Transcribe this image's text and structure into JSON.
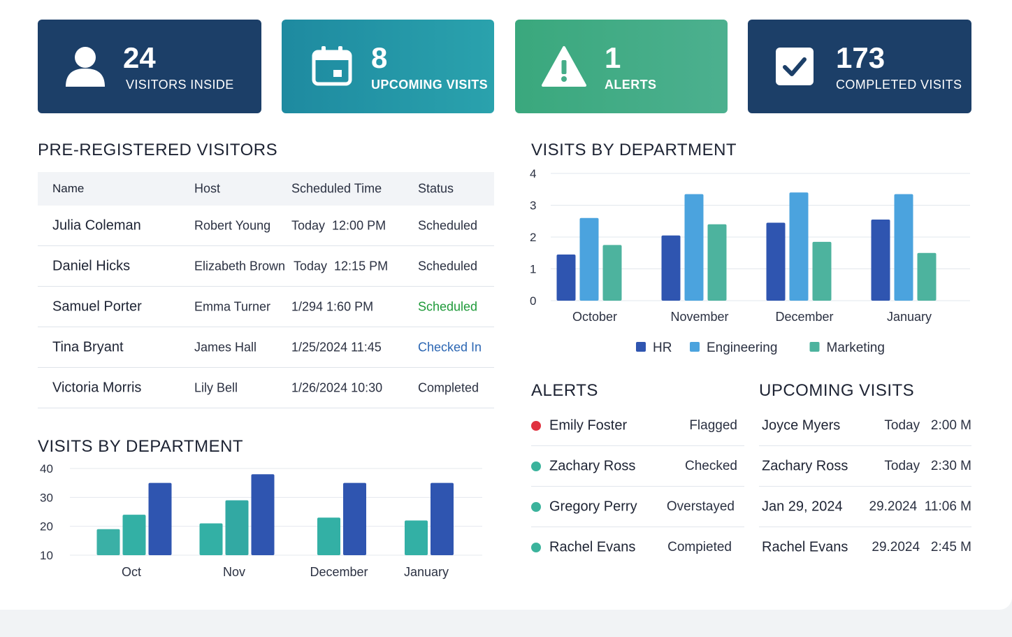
{
  "kpis": [
    {
      "value": "24",
      "label": "VISITORS INSIDE",
      "icon": "user-icon"
    },
    {
      "value": "8",
      "label": "UPCOMING VISITS",
      "icon": "calendar-icon"
    },
    {
      "value": "1",
      "label": "ALERTS",
      "icon": "warning-icon"
    },
    {
      "value": "173",
      "label": "COMPLETED VISITS",
      "icon": "checkbox-icon"
    }
  ],
  "preregistered": {
    "title": "PRE-REGISTERED VISITORS",
    "columns": [
      "Name",
      "Host",
      "Scheduled Time",
      "Status"
    ],
    "rows": [
      {
        "name": "Julia Coleman",
        "host": "Robert Young",
        "time": "Today  12:00 PM",
        "status": "Scheduled"
      },
      {
        "name": "Daniel Hicks",
        "host": "Elizabeth Brown",
        "time": "Today  12:15 PM",
        "status": "Scheduled"
      },
      {
        "name": "Samuel Porter",
        "host": "Emma Turner",
        "time": "1/294 1:60 PM",
        "status": "Scheduled"
      },
      {
        "name": "Tina Bryant",
        "host": "James Hall",
        "time": "1/25/2024 11:45",
        "status": "Checked In"
      },
      {
        "name": "Victoria Morris",
        "host": "Lily Bell",
        "time": "1/26/2024 10:30",
        "status": "Completed"
      }
    ]
  },
  "colors": {
    "hr": "#2f55b0",
    "engineering": "#4ba3de",
    "marketing": "#4db39e",
    "teal": "#36b2a7",
    "navy": "#1c3f68",
    "alert_red": "#e0313f",
    "alert_teal": "#3bb39c"
  },
  "chart_data": [
    {
      "type": "bar",
      "title": "VISITS BY DEPARTMENT",
      "categories": [
        "October",
        "November",
        "December",
        "January"
      ],
      "series": [
        {
          "name": "HR",
          "values": [
            1.45,
            2.05,
            2.45,
            2.55
          ]
        },
        {
          "name": "Engineering",
          "values": [
            2.6,
            3.35,
            3.4,
            3.35
          ]
        },
        {
          "name": "Marketing",
          "values": [
            1.75,
            2.4,
            1.85,
            1.5
          ]
        }
      ],
      "yticks": [
        "0",
        "1",
        "2",
        "3",
        "4"
      ],
      "ylim": [
        0,
        4
      ],
      "grid": true,
      "legend": "bottom"
    },
    {
      "type": "bar",
      "title": "VISITS BY DEPARTMENT",
      "categories": [
        "Oct",
        "Nov",
        "December",
        "January"
      ],
      "series": [
        {
          "values": [
            19,
            0,
            0,
            0
          ]
        },
        {
          "values": [
            24,
            21,
            23,
            22
          ]
        },
        {
          "values": [
            0,
            29,
            0,
            0
          ]
        },
        {
          "values": [
            35,
            38,
            35,
            35
          ]
        }
      ],
      "yticks": [
        "40",
        "30",
        "20",
        "10"
      ],
      "ylim": [
        10,
        40
      ],
      "grid": true
    }
  ],
  "alerts": {
    "title": "ALERTS",
    "items": [
      {
        "name": "Emily Foster",
        "status": "Flagged",
        "level": "red"
      },
      {
        "name": "Zachary Ross",
        "status": "Checked",
        "level": "teal"
      },
      {
        "name": "Gregory Perry",
        "status": "Overstayed",
        "level": "teal"
      },
      {
        "name": "Rachel Evans",
        "status": "Compieted",
        "level": "teal"
      }
    ]
  },
  "upcoming": {
    "title": "UPCOMING VISITS",
    "items": [
      {
        "name": "Joyce Myers",
        "time": "Today   2:00 M"
      },
      {
        "name": "Zachary Ross",
        "time": "Today   2:30 M"
      },
      {
        "name": "Jan 29, 2024",
        "time": "29.2024  11:06 M"
      },
      {
        "name": "Rachel Evans",
        "time": "29.2024   2:45 M"
      }
    ]
  }
}
